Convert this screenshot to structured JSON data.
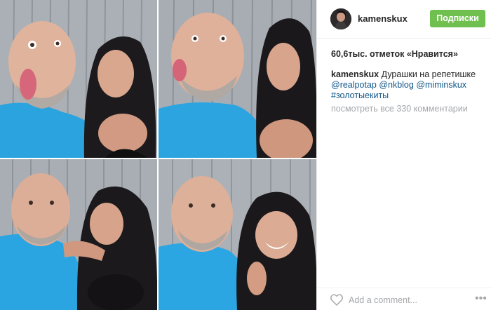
{
  "post": {
    "photos": [
      {
        "id": "photo-1",
        "description": "man-sticking-tongue-out-woman-pouting"
      },
      {
        "id": "photo-2",
        "description": "man-sticking-tongue-out-woman-pouting-close"
      },
      {
        "id": "photo-3",
        "description": "man-and-woman-smiling"
      },
      {
        "id": "photo-4",
        "description": "man-and-woman-laughing"
      }
    ]
  },
  "header": {
    "username": "kamenskux",
    "follow_label": "Подписки",
    "follow_color": "#70c050"
  },
  "likes": {
    "text": "60,6тыс. отметок «Нравится»"
  },
  "caption": {
    "username": "kamenskux",
    "text": " Дурашки на репетишке",
    "mentions": [
      "@realpotap",
      "@nkblog",
      "@miminskux"
    ],
    "hashtag": "#золотыекиты",
    "link_color": "#125688"
  },
  "comments": {
    "view_all_label": "посмотреть все 330 комментарии"
  },
  "footer": {
    "comment_placeholder": "Add a comment...",
    "like_icon": "heart-icon",
    "more_icon": "ellipsis-icon"
  }
}
